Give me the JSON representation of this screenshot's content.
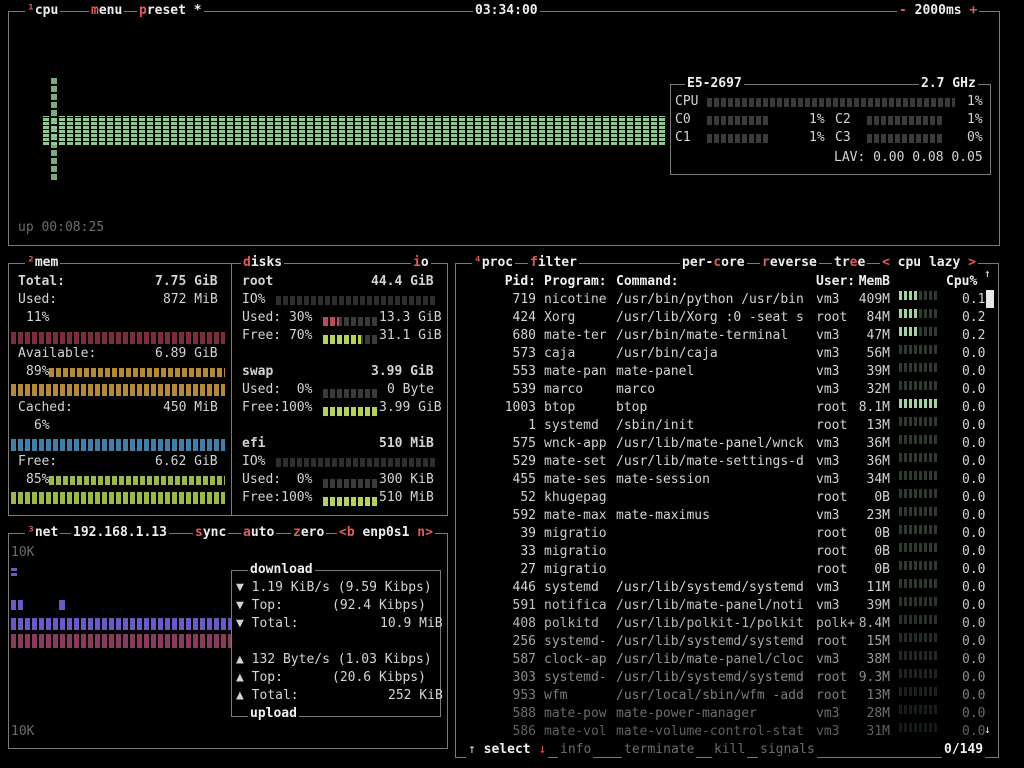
{
  "cpu": {
    "tag": "¹",
    "label": "cpu",
    "menu": "menu",
    "preset": "preset",
    "star": "*",
    "clock": "03:34:00",
    "minus": "-",
    "interval": "2000ms",
    "plus": "+",
    "uptime": "up 00:08:25",
    "model": "E5-2697",
    "freq": "2.7 GHz",
    "total": {
      "label": "CPU",
      "value": "1%",
      "fill": 0.01
    },
    "cores": [
      {
        "label": "C0",
        "value": "1%",
        "fill": 0.01
      },
      {
        "label": "C1",
        "value": "1%",
        "fill": 0.01
      },
      {
        "label": "C2",
        "value": "1%",
        "fill": 0.01
      },
      {
        "label": "C3",
        "value": "0%",
        "fill": 0.0
      }
    ],
    "lav": "LAV: 0.00 0.08 0.05"
  },
  "mem": {
    "tag": "²",
    "label": "mem",
    "total_label": "Total:",
    "total_value": "7.75 GiB",
    "used_label": "Used:",
    "used_value": "872 MiB",
    "used_pct": "11%",
    "available_label": "Available:",
    "available_value": "6.89 GiB",
    "available_pct": "89%",
    "cached_label": "Cached:",
    "cached_value": "450 MiB",
    "cached_pct": "6%",
    "free_label": "Free:",
    "free_value": "6.62 GiB",
    "free_pct": "85%"
  },
  "disks": {
    "label": "disks",
    "io_label": "io",
    "root": {
      "name": "root",
      "size": "44.4 GiB",
      "io": "IO%",
      "used_label": "Used: 30%",
      "used_value": "13.3 GiB",
      "used_fill": 0.3,
      "free_label": "Free: 70%",
      "free_value": "31.1 GiB",
      "free_fill": 0.7
    },
    "swap": {
      "name": "swap",
      "size": "3.99 GiB",
      "used_label": "Used:  0%",
      "used_value": "0 Byte",
      "used_fill": 0.0,
      "free_label": "Free:100%",
      "free_value": "3.99 GiB",
      "free_fill": 1.0
    },
    "efi": {
      "name": "efi",
      "size": "510 MiB",
      "io": "IO%",
      "used_label": "Used:  0%",
      "used_value": "300 KiB",
      "used_fill": 0.0,
      "free_label": "Free:100%",
      "free_value": "510 MiB",
      "free_fill": 1.0
    }
  },
  "net": {
    "tag": "³",
    "label": "net",
    "ip": "192.168.1.13",
    "sync": "sync",
    "auto": "auto",
    "zero": "zero",
    "prev": "<b",
    "iface": "enp0s1",
    "next": "n>",
    "scale_top": "10K",
    "scale_bottom": "10K",
    "download_title": "download",
    "download": [
      {
        "arrow": "▼",
        "label": "1.19 KiB/s",
        "value": "(9.59 Kibps)"
      },
      {
        "arrow": "▼",
        "label": "Top:",
        "value": "(92.4 Kibps)"
      },
      {
        "arrow": "▼",
        "label": "Total:",
        "value": "10.9 MiB"
      }
    ],
    "upload_title": "upload",
    "upload": [
      {
        "arrow": "▲",
        "label": "132 Byte/s",
        "value": "(1.03 Kibps)"
      },
      {
        "arrow": "▲",
        "label": "Top:",
        "value": "(20.6 Kibps)"
      },
      {
        "arrow": "▲",
        "label": "Total:",
        "value": "252 KiB"
      }
    ]
  },
  "proc": {
    "tag": "⁴",
    "label": "proc",
    "filter": "filter",
    "percore": "per-core",
    "reverse": "reverse",
    "tree": "tree",
    "sort_prev": "<",
    "sort": "cpu lazy",
    "sort_next": ">",
    "columns": {
      "pid": "Pid:",
      "program": "Program:",
      "command": "Command:",
      "user": "User:",
      "mem": "MemB",
      "cpu": "Cpu%"
    },
    "rows": [
      {
        "pid": "719",
        "program": "nicotine",
        "command": "/usr/bin/python /usr/bin",
        "user": "vm3",
        "mem": "409M",
        "cpu": "0.1",
        "bar": 0.5
      },
      {
        "pid": "424",
        "program": "Xorg",
        "command": "/usr/lib/Xorg :0 -seat s",
        "user": "root",
        "mem": "84M",
        "cpu": "0.2",
        "bar": 0.5
      },
      {
        "pid": "680",
        "program": "mate-ter",
        "command": "/usr/bin/mate-terminal",
        "user": "vm3",
        "mem": "47M",
        "cpu": "0.2",
        "bar": 0.5
      },
      {
        "pid": "573",
        "program": "caja",
        "command": "/usr/bin/caja",
        "user": "vm3",
        "mem": "56M",
        "cpu": "0.0",
        "bar": 0.0
      },
      {
        "pid": "553",
        "program": "mate-pan",
        "command": "mate-panel",
        "user": "vm3",
        "mem": "39M",
        "cpu": "0.0",
        "bar": 0.0
      },
      {
        "pid": "539",
        "program": "marco",
        "command": "marco",
        "user": "vm3",
        "mem": "32M",
        "cpu": "0.0",
        "bar": 0.0
      },
      {
        "pid": "1003",
        "program": "btop",
        "command": "btop",
        "user": "root",
        "mem": "8.1M",
        "cpu": "0.0",
        "bar": 1.0
      },
      {
        "pid": "1",
        "program": "systemd",
        "command": "/sbin/init",
        "user": "root",
        "mem": "13M",
        "cpu": "0.0",
        "bar": 0.0
      },
      {
        "pid": "575",
        "program": "wnck-app",
        "command": "/usr/lib/mate-panel/wnck",
        "user": "vm3",
        "mem": "36M",
        "cpu": "0.0",
        "bar": 0.0
      },
      {
        "pid": "529",
        "program": "mate-set",
        "command": "/usr/lib/mate-settings-d",
        "user": "vm3",
        "mem": "36M",
        "cpu": "0.0",
        "bar": 0.0
      },
      {
        "pid": "455",
        "program": "mate-ses",
        "command": "mate-session",
        "user": "vm3",
        "mem": "34M",
        "cpu": "0.0",
        "bar": 0.0
      },
      {
        "pid": "52",
        "program": "khugepag",
        "command": "",
        "user": "root",
        "mem": "0B",
        "cpu": "0.0",
        "bar": 0.0
      },
      {
        "pid": "592",
        "program": "mate-max",
        "command": "mate-maximus",
        "user": "vm3",
        "mem": "23M",
        "cpu": "0.0",
        "bar": 0.0
      },
      {
        "pid": "39",
        "program": "migratio",
        "command": "",
        "user": "root",
        "mem": "0B",
        "cpu": "0.0",
        "bar": 0.0
      },
      {
        "pid": "33",
        "program": "migratio",
        "command": "",
        "user": "root",
        "mem": "0B",
        "cpu": "0.0",
        "bar": 0.0
      },
      {
        "pid": "27",
        "program": "migratio",
        "command": "",
        "user": "root",
        "mem": "0B",
        "cpu": "0.0",
        "bar": 0.0
      },
      {
        "pid": "446",
        "program": "systemd",
        "command": "/usr/lib/systemd/systemd",
        "user": "vm3",
        "mem": "11M",
        "cpu": "0.0",
        "bar": 0.0
      },
      {
        "pid": "591",
        "program": "notifica",
        "command": "/usr/lib/mate-panel/noti",
        "user": "vm3",
        "mem": "39M",
        "cpu": "0.0",
        "bar": 0.0
      },
      {
        "pid": "408",
        "program": "polkitd",
        "command": "/usr/lib/polkit-1/polkit",
        "user": "polk+",
        "mem": "8.4M",
        "cpu": "0.0",
        "bar": 0.0
      },
      {
        "pid": "256",
        "program": "systemd-",
        "command": "/usr/lib/systemd/systemd",
        "user": "root",
        "mem": "15M",
        "cpu": "0.0",
        "bar": 0.0
      },
      {
        "pid": "587",
        "program": "clock-ap",
        "command": "/usr/lib/mate-panel/cloc",
        "user": "vm3",
        "mem": "38M",
        "cpu": "0.0",
        "bar": 0.0
      },
      {
        "pid": "303",
        "program": "systemd-",
        "command": "/usr/lib/systemd/systemd",
        "user": "root",
        "mem": "9.3M",
        "cpu": "0.0",
        "bar": 0.0
      },
      {
        "pid": "953",
        "program": "wfm",
        "command": "/usr/local/sbin/wfm -add",
        "user": "root",
        "mem": "13M",
        "cpu": "0.0",
        "bar": 0.0
      },
      {
        "pid": "588",
        "program": "mate-pow",
        "command": "mate-power-manager",
        "user": "vm3",
        "mem": "28M",
        "cpu": "0.0",
        "bar": 0.0
      },
      {
        "pid": "586",
        "program": "mate-vol",
        "command": "mate-volume-control-stat",
        "user": "vm3",
        "mem": "31M",
        "cpu": "0.0",
        "bar": 0.0
      }
    ],
    "bottom": {
      "up": "↑",
      "select": "select",
      "down": "↓",
      "info": "info",
      "terminate": "terminate",
      "kill": "kill",
      "signals": "signals",
      "count": "0/149"
    }
  },
  "colors": {
    "border": "#7a7a7a",
    "hotkey": "#e05a5a",
    "cpu_graph": "#9fd59f",
    "mem_used": "#c24a4a",
    "mem_available": "#d8b45a",
    "mem_cached": "#4d8fb8",
    "mem_free": "#b6d25a",
    "net_download": "#6a5ac8",
    "net_upload": "#8a3a5a"
  }
}
